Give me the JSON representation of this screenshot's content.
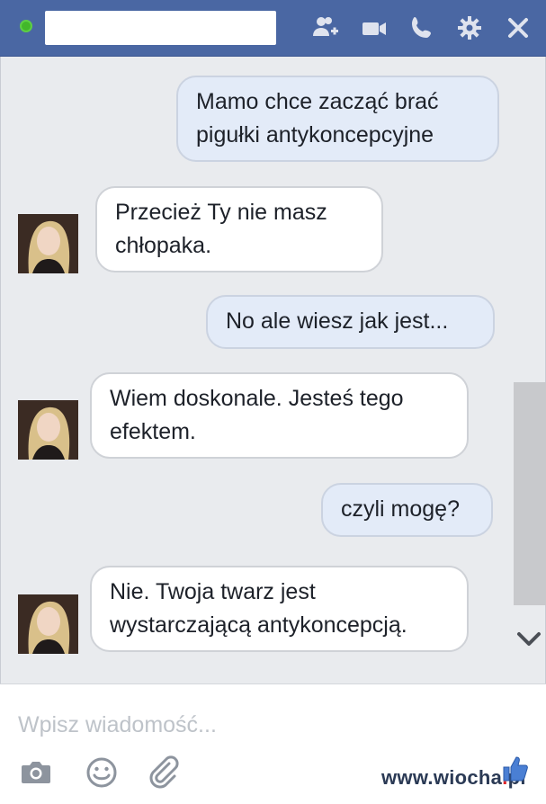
{
  "header": {
    "status": "online",
    "icons": [
      "add-people-icon",
      "video-call-icon",
      "phone-icon",
      "gear-icon",
      "close-icon"
    ],
    "colors": {
      "bar": "#4a67a3",
      "online": "#42b72a"
    }
  },
  "messages": [
    {
      "side": "out",
      "lines": [
        "Mamo chce zacząć brać",
        "pigułki antykoncepcyjne"
      ]
    },
    {
      "side": "in",
      "lines": [
        "Przecież Ty nie masz",
        "chłopaka."
      ]
    },
    {
      "side": "out",
      "lines": [
        "No ale wiesz jak jest..."
      ]
    },
    {
      "side": "in",
      "lines": [
        "Wiem doskonale. Jesteś tego",
        "efektem."
      ]
    },
    {
      "side": "out",
      "lines": [
        "czyli mogę?"
      ]
    },
    {
      "side": "in",
      "lines": [
        "Nie. Twoja twarz jest",
        "wystarczającą antykoncepcją."
      ]
    }
  ],
  "composer": {
    "placeholder": "Wpisz wiadomość...",
    "icons": [
      "camera-icon",
      "emoji-icon",
      "attachment-icon"
    ]
  },
  "watermark": {
    "text_a": "www.wiocha",
    "dot": ".",
    "text_b": "pl"
  }
}
